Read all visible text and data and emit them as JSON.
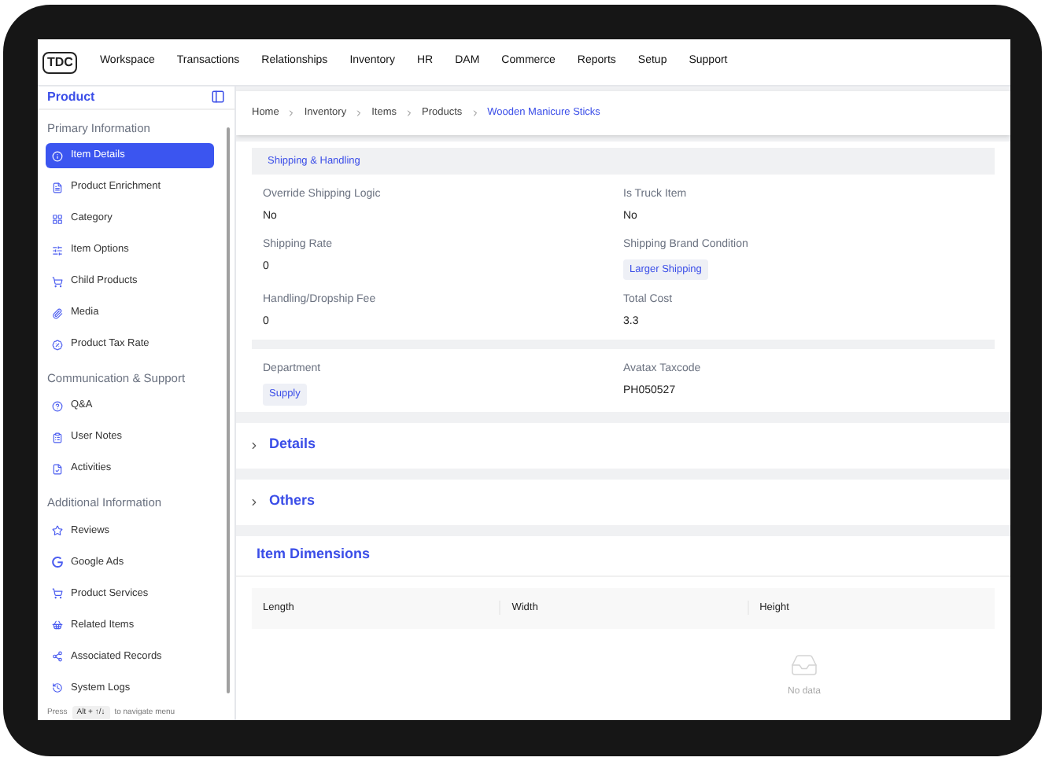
{
  "logo": "TDC",
  "nav": [
    "Workspace",
    "Transactions",
    "Relationships",
    "Inventory",
    "HR",
    "DAM",
    "Commerce",
    "Reports",
    "Setup",
    "Support"
  ],
  "sidebar": {
    "title": "Product",
    "sections": [
      {
        "title": "Primary Information",
        "items": [
          {
            "label": "Item Details",
            "selected": true
          },
          {
            "label": "Product Enrichment",
            "selected": false
          },
          {
            "label": "Category",
            "selected": false
          },
          {
            "label": "Item Options",
            "selected": false
          },
          {
            "label": "Child Products",
            "selected": false
          },
          {
            "label": "Media",
            "selected": false
          },
          {
            "label": "Product Tax Rate",
            "selected": false
          }
        ]
      },
      {
        "title": "Communication & Support",
        "items": [
          {
            "label": "Q&A",
            "selected": false
          },
          {
            "label": "User Notes",
            "selected": false
          },
          {
            "label": "Activities",
            "selected": false
          }
        ]
      },
      {
        "title": "Additional Information",
        "items": [
          {
            "label": "Reviews",
            "selected": false
          },
          {
            "label": "Google Ads",
            "selected": false
          },
          {
            "label": "Product Services",
            "selected": false
          },
          {
            "label": "Related Items",
            "selected": false
          },
          {
            "label": "Associated Records",
            "selected": false
          },
          {
            "label": "System Logs",
            "selected": false
          }
        ]
      }
    ],
    "hint": {
      "before": "Press",
      "key": "Alt + ↑/↓",
      "after": "to navigate menu"
    }
  },
  "breadcrumb": [
    "Home",
    "Inventory",
    "Items",
    "Products",
    "Wooden Manicure Sticks"
  ],
  "shipping": {
    "title": "Shipping & Handling",
    "fields": [
      {
        "label": "Override Shipping Logic",
        "value": "No",
        "kind": "text"
      },
      {
        "label": "Is Truck Item",
        "value": "No",
        "kind": "text"
      },
      {
        "label": "Shipping Rate",
        "value": "0",
        "kind": "text"
      },
      {
        "label": "Shipping Brand Condition",
        "value": "Larger Shipping",
        "kind": "tag"
      },
      {
        "label": "Handling/Dropship Fee",
        "value": "0",
        "kind": "text"
      },
      {
        "label": "Total Cost",
        "value": "3.3",
        "kind": "text"
      }
    ]
  },
  "extra_fields": [
    {
      "label": "Department",
      "value": "Supply",
      "kind": "tag"
    },
    {
      "label": "Avatax Taxcode",
      "value": "PH050527",
      "kind": "text"
    }
  ],
  "collapsibles": [
    {
      "title": "Details",
      "expanded": false
    },
    {
      "title": "Others",
      "expanded": false
    }
  ],
  "dimensions": {
    "title": "Item Dimensions",
    "columns": [
      "Length",
      "Width",
      "Height"
    ],
    "empty": "No data"
  }
}
